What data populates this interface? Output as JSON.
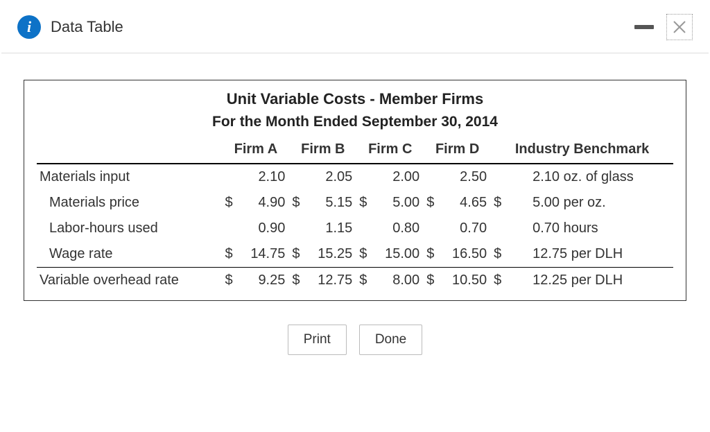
{
  "header": {
    "title": "Data Table",
    "info_icon_label": "i"
  },
  "table": {
    "title": "Unit Variable Costs - Member Firms",
    "subtitle": "For the Month Ended September 30, 2014",
    "columns": [
      "Firm A",
      "Firm B",
      "Firm C",
      "Firm D",
      "Industry Benchmark"
    ],
    "rows": [
      {
        "label": "Materials input",
        "indent": false,
        "currency": false,
        "values": [
          "2.10",
          "2.05",
          "2.00",
          "2.50"
        ],
        "benchmark": "2.10 oz. of glass"
      },
      {
        "label": "Materials price",
        "indent": true,
        "currency": true,
        "values": [
          "4.90",
          "5.15",
          "5.00",
          "4.65"
        ],
        "benchmark": "5.00 per oz."
      },
      {
        "label": "Labor-hours used",
        "indent": true,
        "currency": false,
        "values": [
          "0.90",
          "1.15",
          "0.80",
          "0.70"
        ],
        "benchmark": "0.70 hours"
      },
      {
        "label": "Wage rate",
        "indent": true,
        "currency": true,
        "values": [
          "14.75",
          "15.25",
          "15.00",
          "16.50"
        ],
        "benchmark": "12.75 per DLH"
      },
      {
        "label": "Variable overhead rate",
        "indent": false,
        "currency": true,
        "values": [
          "9.25",
          "12.75",
          "8.00",
          "10.50"
        ],
        "benchmark": "12.25 per DLH"
      }
    ],
    "currency_symbol": "$"
  },
  "buttons": {
    "print": "Print",
    "done": "Done"
  }
}
